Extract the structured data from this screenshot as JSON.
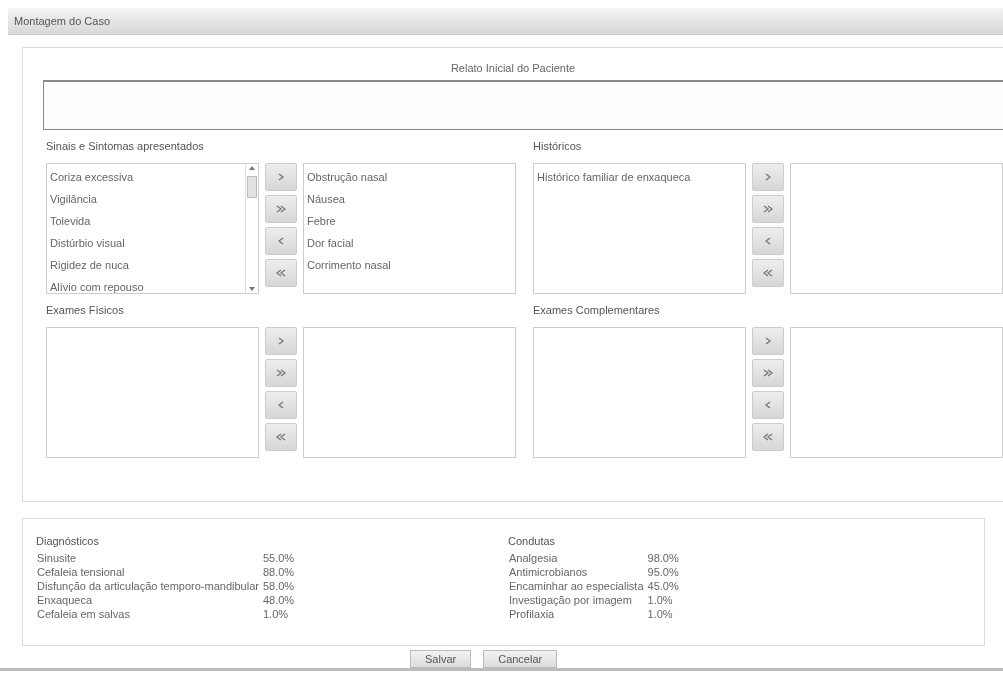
{
  "window": {
    "title": "Montagem do Caso"
  },
  "relato": {
    "label": "Relato Inicial do Paciente"
  },
  "pickers": [
    {
      "title": "Sinais e Sintomas apresentados",
      "scrollbar": true,
      "available": [
        "Coriza excessiva",
        "Vigilância",
        "Tolevida",
        "Distúrbio visual",
        "Rigidez de nuca",
        "Alívio com repouso"
      ],
      "chosen": [
        "Obstrução nasal",
        "Náusea",
        "Febre",
        "Dor facial",
        "Corrimento nasal"
      ]
    },
    {
      "title": "Históricos",
      "scrollbar": false,
      "available": [
        "Histórico familiar de enxaqueca"
      ]
    },
    {
      "title": "Exames Físicos",
      "scrollbar": false
    },
    {
      "title": "Exames Complementares",
      "scrollbar": false
    }
  ],
  "results": [
    {
      "title": "Diagnósticos",
      "items": [
        {
          "label": "Sinusite",
          "value": "55.0%"
        },
        {
          "label": "Cefaleia tensional",
          "value": "88.0%"
        },
        {
          "label": "Disfunção da articulação temporo-mandibular",
          "value": "58.0%"
        },
        {
          "label": "Enxaqueca",
          "value": "48.0%"
        },
        {
          "label": "Cefaleia em salvas",
          "value": "1.0%"
        }
      ]
    },
    {
      "title": "Condutas",
      "items": [
        {
          "label": "Analgesia",
          "value": "98.0%"
        },
        {
          "label": "Antimicrobianos",
          "value": "95.0%"
        },
        {
          "label": "Encaminhar ao especialista",
          "value": "45.0%"
        },
        {
          "label": "Investigação por imagem",
          "value": "1.0%"
        },
        {
          "label": "Profilaxia",
          "value": "1.0%"
        }
      ]
    }
  ],
  "actions": [
    "Salvar",
    "Cancelar"
  ]
}
